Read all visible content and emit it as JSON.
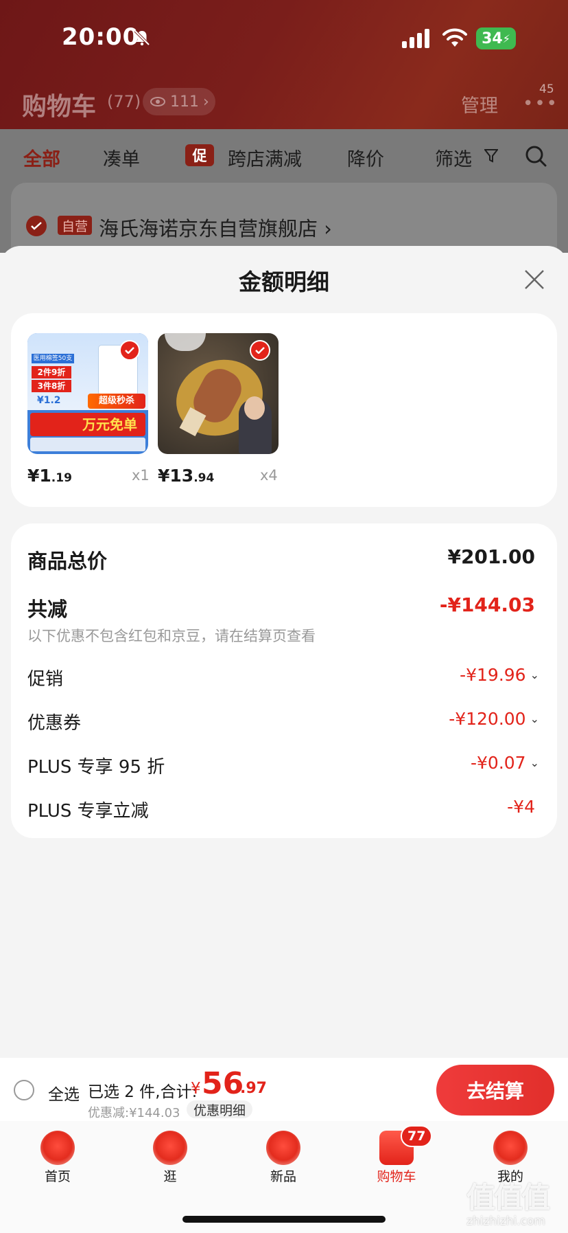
{
  "status_bar": {
    "time": "20:00",
    "battery": "34"
  },
  "header": {
    "title": "购物车",
    "count": "(77)",
    "views": "111",
    "manage": "管理",
    "more_badge": "45"
  },
  "filter_tabs": [
    {
      "label": "全部"
    },
    {
      "label": "凑单"
    },
    {
      "tag": "促",
      "label": "跨店满减"
    },
    {
      "label": "降价"
    },
    {
      "label": "筛选"
    }
  ],
  "store": {
    "tag": "自营",
    "name": "海氏海诺京东自营旗舰店"
  },
  "sheet": {
    "title": "金额明细",
    "products": [
      {
        "price_int": "¥1",
        "price_dec": ".19",
        "qty": "x1",
        "thumb_text": [
          "医用棉签50支",
          "2件9折",
          "3件8折",
          "¥1.2",
          "超级秒杀",
          "万元免单"
        ]
      },
      {
        "price_int": "¥13",
        "price_dec": ".94",
        "qty": "x4"
      }
    ],
    "summary": {
      "total_label": "商品总价",
      "total_value": "¥201.00",
      "reduce_label": "共减",
      "reduce_value": "-¥144.03",
      "note": "以下优惠不包含红包和京豆，请在结算页查看",
      "rows": [
        {
          "label": "促销",
          "value": "-¥19.96"
        },
        {
          "label": "优惠券",
          "value": "-¥120.00"
        },
        {
          "label": "PLUS 专享 95 折",
          "value": "-¥0.07"
        },
        {
          "label": "PLUS 专享立减",
          "value": "-¥4"
        }
      ]
    }
  },
  "bottom_bar": {
    "select_all": "全选",
    "selected_text": "已选 2 件,合计:",
    "currency": "¥",
    "total_int": "56",
    "total_dec": ".97",
    "discount_text": "优惠减:¥144.03",
    "detail_button": "优惠明细",
    "checkout": "去结算"
  },
  "tab_bar": {
    "items": [
      {
        "label": "首页"
      },
      {
        "label": "逛"
      },
      {
        "label": "新品"
      },
      {
        "label": "购物车"
      },
      {
        "label": "我的"
      }
    ],
    "cart_badge": "77"
  },
  "watermark": {
    "main": "值值值",
    "site": "zhizhizhi.com"
  },
  "colors": {
    "accent": "#e2231a",
    "header": "#7a1e1b",
    "sheet_bg": "#f4f4f4"
  }
}
